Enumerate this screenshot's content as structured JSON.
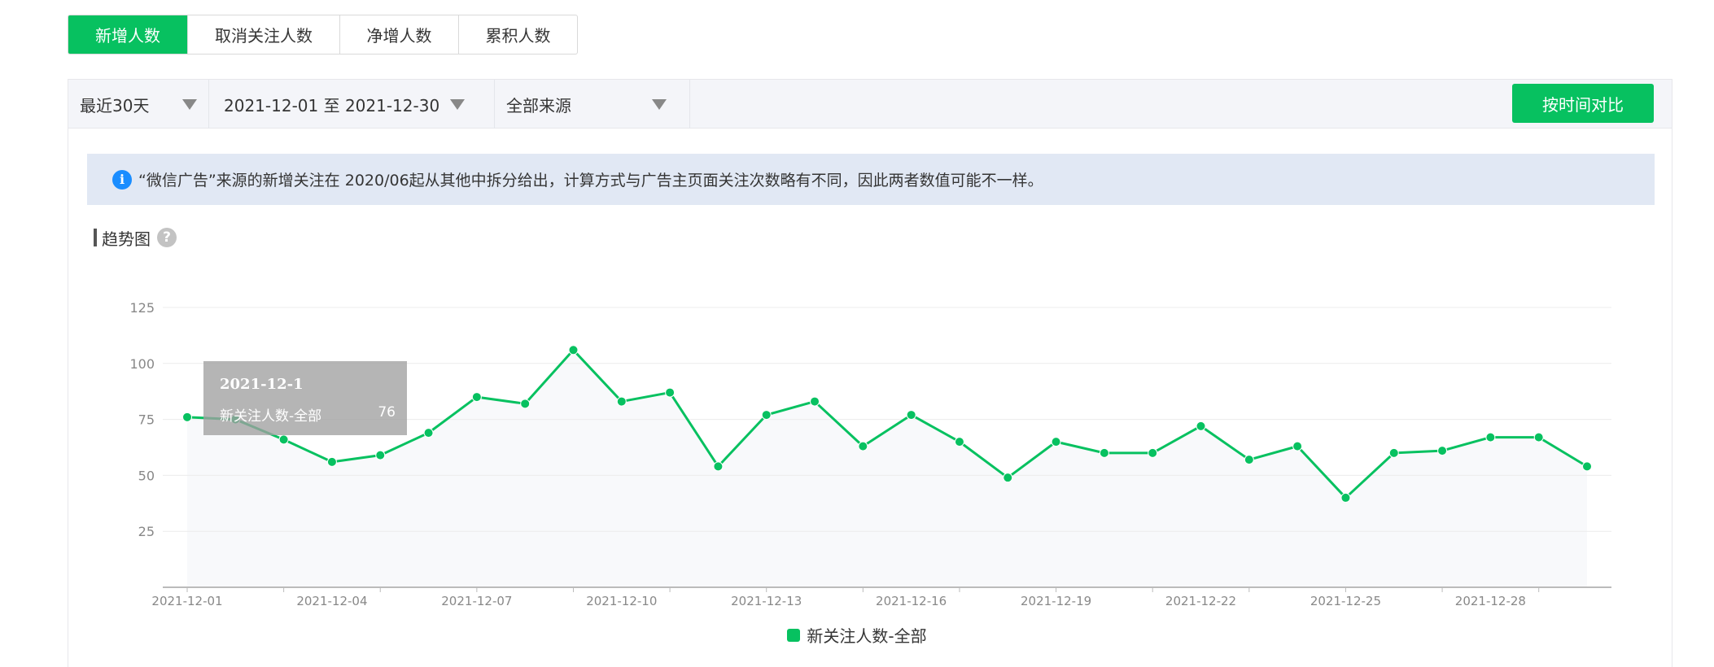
{
  "tabs": [
    {
      "label": "新增人数",
      "active": true
    },
    {
      "label": "取消关注人数",
      "active": false
    },
    {
      "label": "净增人数",
      "active": false
    },
    {
      "label": "累积人数",
      "active": false
    }
  ],
  "filters": {
    "period": "最近30天",
    "date_range": "2021-12-01 至 2021-12-30",
    "source": "全部来源",
    "compare_button": "按时间对比"
  },
  "notice": {
    "icon": "info-icon",
    "text": "“微信广告”来源的新增关注在 2020/06起从其他中拆分给出，计算方式与广告主页面关注次数略有不同，因此两者数值可能不一样。"
  },
  "section": {
    "title": "趋势图",
    "help_icon": "question-mark-icon"
  },
  "tooltip": {
    "date": "2021-12-1",
    "series": "新关注人数-全部",
    "value": "76"
  },
  "colors": {
    "accent": "#07c160",
    "line": "#07c160",
    "area": "#f8f9fb",
    "grid": "#ececec"
  },
  "chart_data": {
    "type": "line",
    "title": "",
    "xlabel": "",
    "ylabel": "",
    "x": [
      "2021-12-01",
      "2021-12-02",
      "2021-12-03",
      "2021-12-04",
      "2021-12-05",
      "2021-12-06",
      "2021-12-07",
      "2021-12-08",
      "2021-12-09",
      "2021-12-10",
      "2021-12-11",
      "2021-12-12",
      "2021-12-13",
      "2021-12-14",
      "2021-12-15",
      "2021-12-16",
      "2021-12-17",
      "2021-12-18",
      "2021-12-19",
      "2021-12-20",
      "2021-12-21",
      "2021-12-22",
      "2021-12-23",
      "2021-12-24",
      "2021-12-25",
      "2021-12-26",
      "2021-12-27",
      "2021-12-28",
      "2021-12-29",
      "2021-12-30"
    ],
    "x_tick_labels": [
      "2021-12-01",
      "2021-12-04",
      "2021-12-07",
      "2021-12-10",
      "2021-12-13",
      "2021-12-16",
      "2021-12-19",
      "2021-12-22",
      "2021-12-25",
      "2021-12-28"
    ],
    "y_ticks": [
      25,
      50,
      75,
      100,
      125
    ],
    "ylim": [
      0,
      125
    ],
    "grid": true,
    "legend_position": "bottom-center",
    "series": [
      {
        "name": "新关注人数-全部",
        "values": [
          76,
          75,
          66,
          56,
          59,
          69,
          85,
          82,
          106,
          83,
          87,
          54,
          77,
          83,
          63,
          77,
          65,
          49,
          65,
          60,
          60,
          72,
          57,
          63,
          40,
          60,
          61,
          67,
          67,
          54
        ]
      }
    ]
  }
}
